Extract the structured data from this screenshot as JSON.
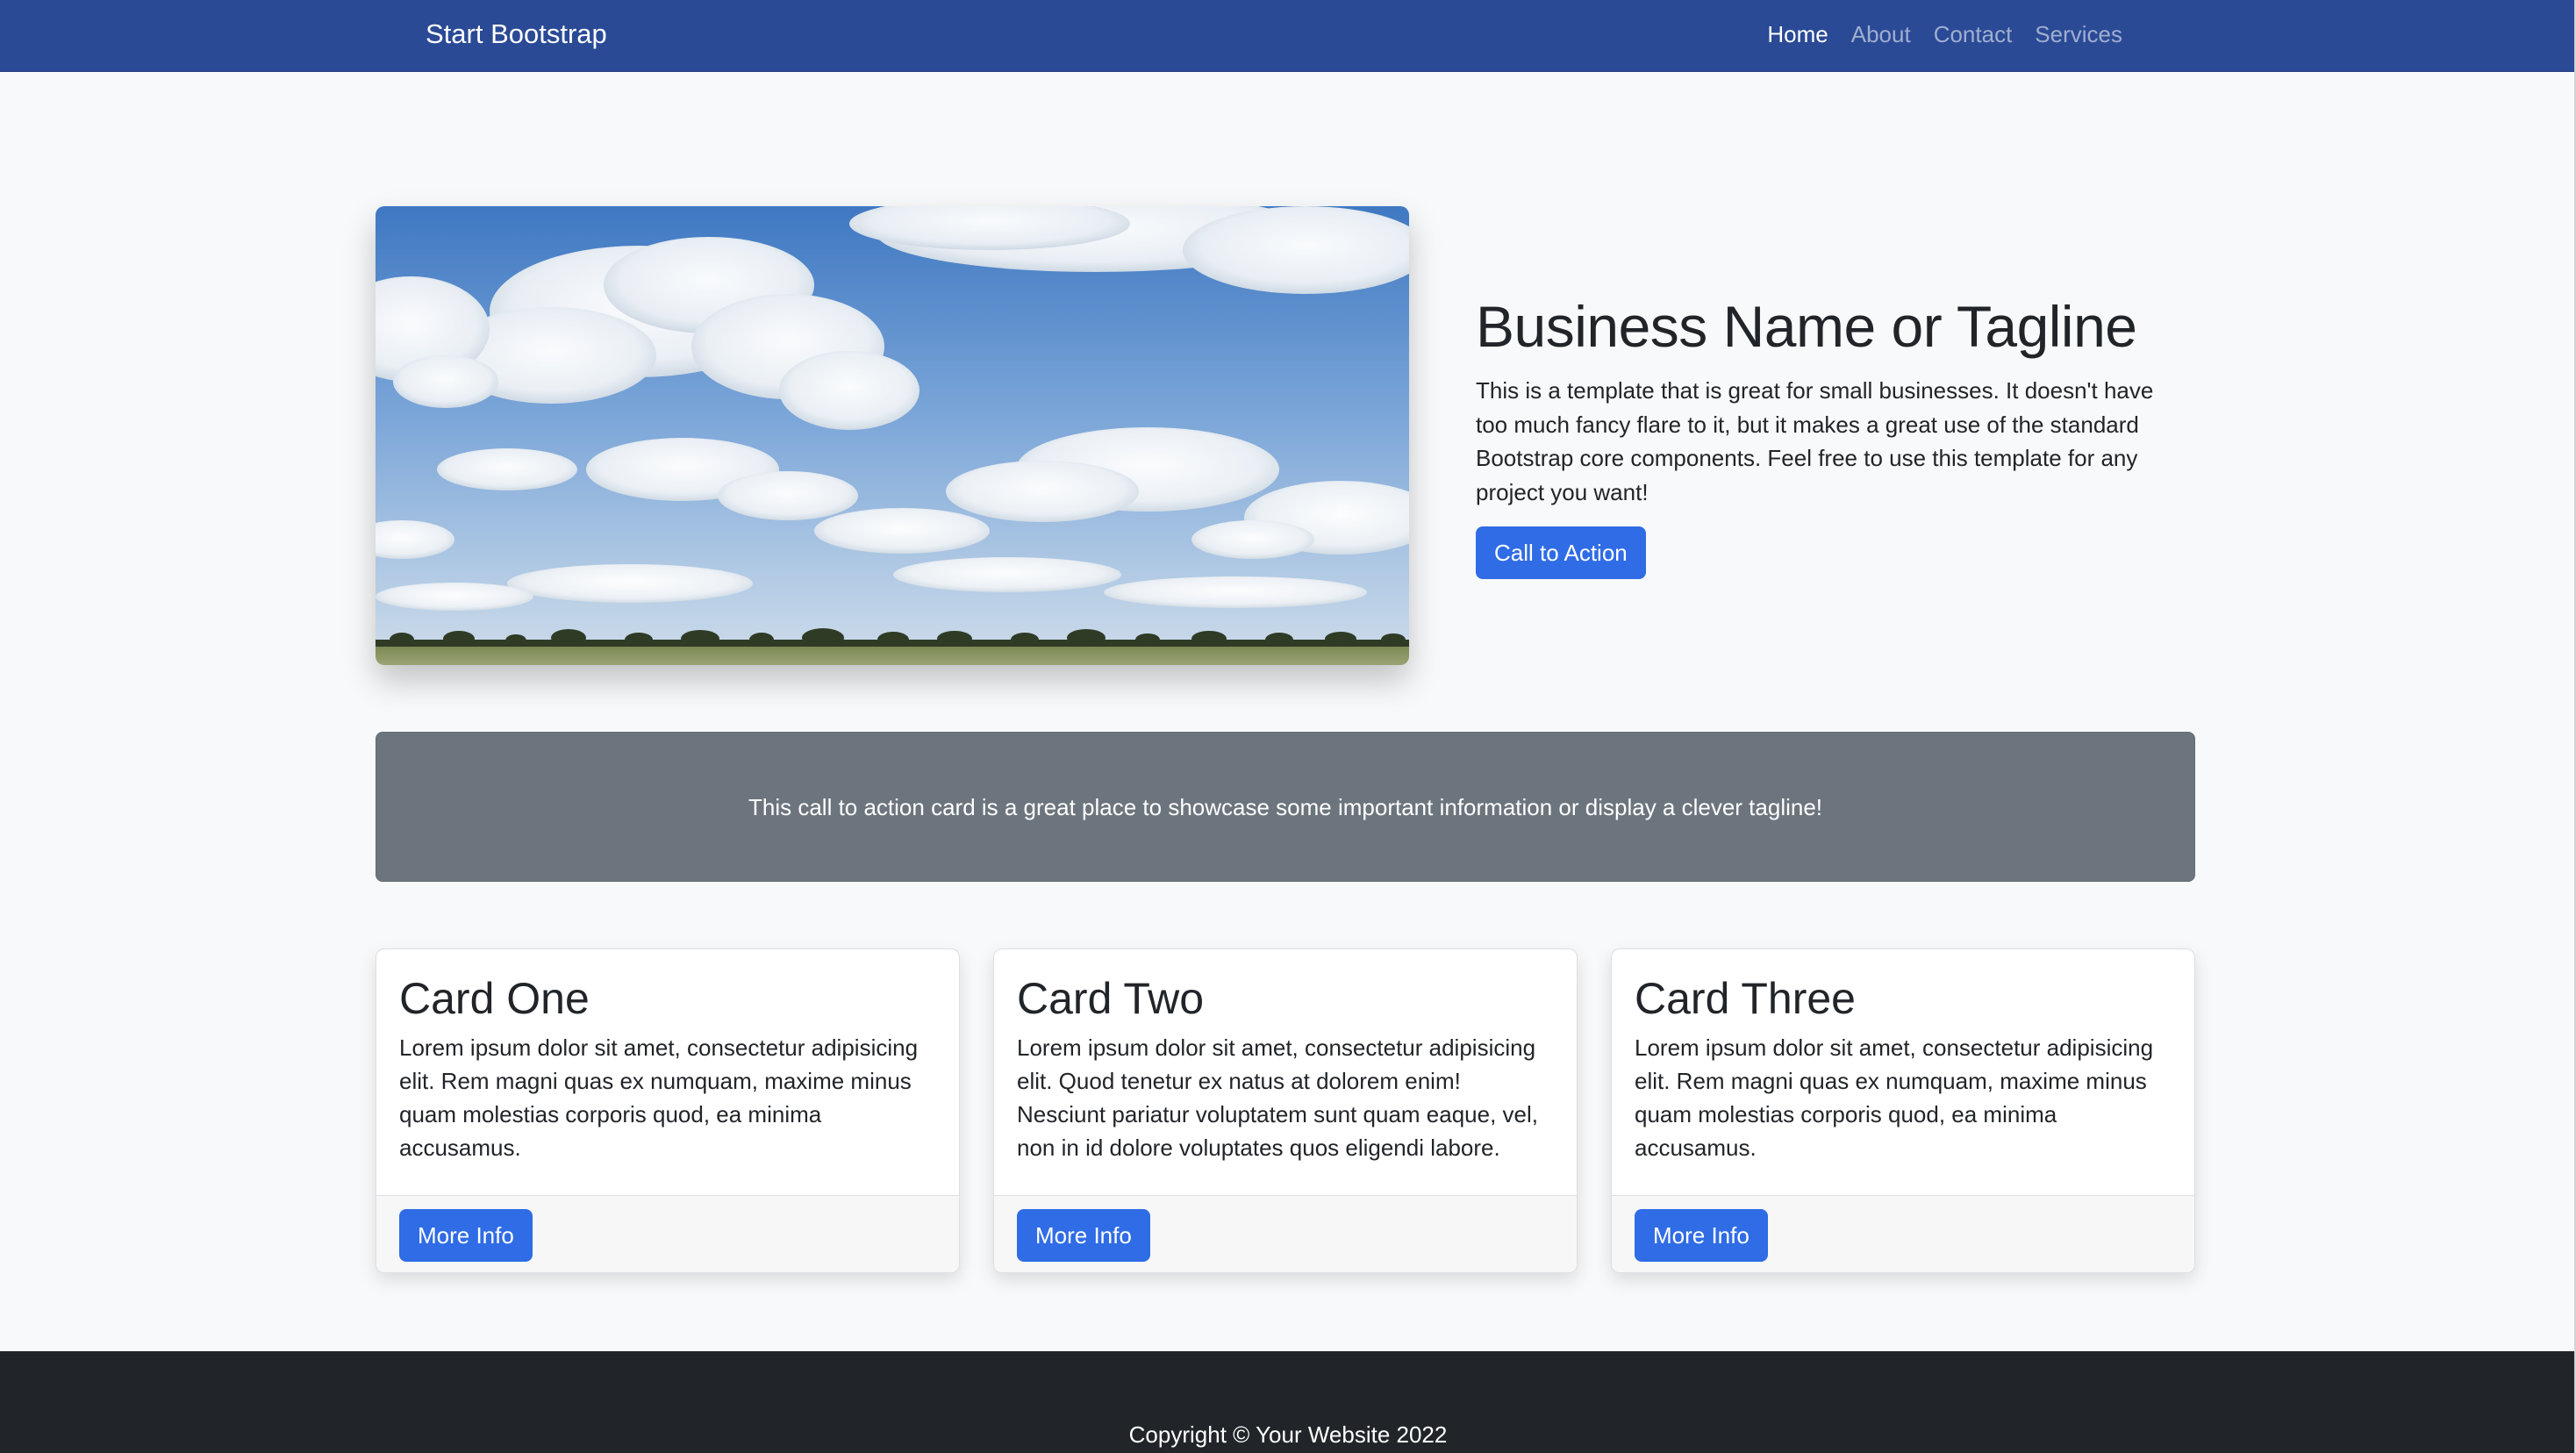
{
  "navbar": {
    "brand": "Start Bootstrap",
    "links": [
      {
        "label": "Home",
        "active": true
      },
      {
        "label": "About",
        "active": false
      },
      {
        "label": "Contact",
        "active": false
      },
      {
        "label": "Services",
        "active": false
      }
    ]
  },
  "hero": {
    "image_alt": "sky-with-clouds-image",
    "title": "Business Name or Tagline",
    "lead": "This is a template that is great for small businesses. It doesn't have too much fancy flare to it, but it makes a great use of the standard Bootstrap core components. Feel free to use this template for any project you want!",
    "button_label": "Call to Action"
  },
  "callout": {
    "text": "This call to action card is a great place to showcase some important information or display a clever tagline!"
  },
  "cards": [
    {
      "title": "Card One",
      "text": "Lorem ipsum dolor sit amet, consectetur adipisicing elit. Rem magni quas ex numquam, maxime minus quam molestias corporis quod, ea minima accusamus.",
      "button_label": "More Info"
    },
    {
      "title": "Card Two",
      "text": "Lorem ipsum dolor sit amet, consectetur adipisicing elit. Quod tenetur ex natus at dolorem enim! Nesciunt pariatur voluptatem sunt quam eaque, vel, non in id dolore voluptates quos eligendi labore.",
      "button_label": "More Info"
    },
    {
      "title": "Card Three",
      "text": "Lorem ipsum dolor sit amet, consectetur adipisicing elit. Rem magni quas ex numquam, maxime minus quam molestias corporis quod, ea minima accusamus.",
      "button_label": "More Info"
    }
  ],
  "footer": {
    "copyright": "Copyright © Your Website 2022"
  },
  "colors": {
    "navbar": "#2a4a96",
    "primary_button": "#2f6ce5",
    "callout": "#6c757d",
    "footer": "#212529",
    "page_bg": "#f8f9fa"
  }
}
